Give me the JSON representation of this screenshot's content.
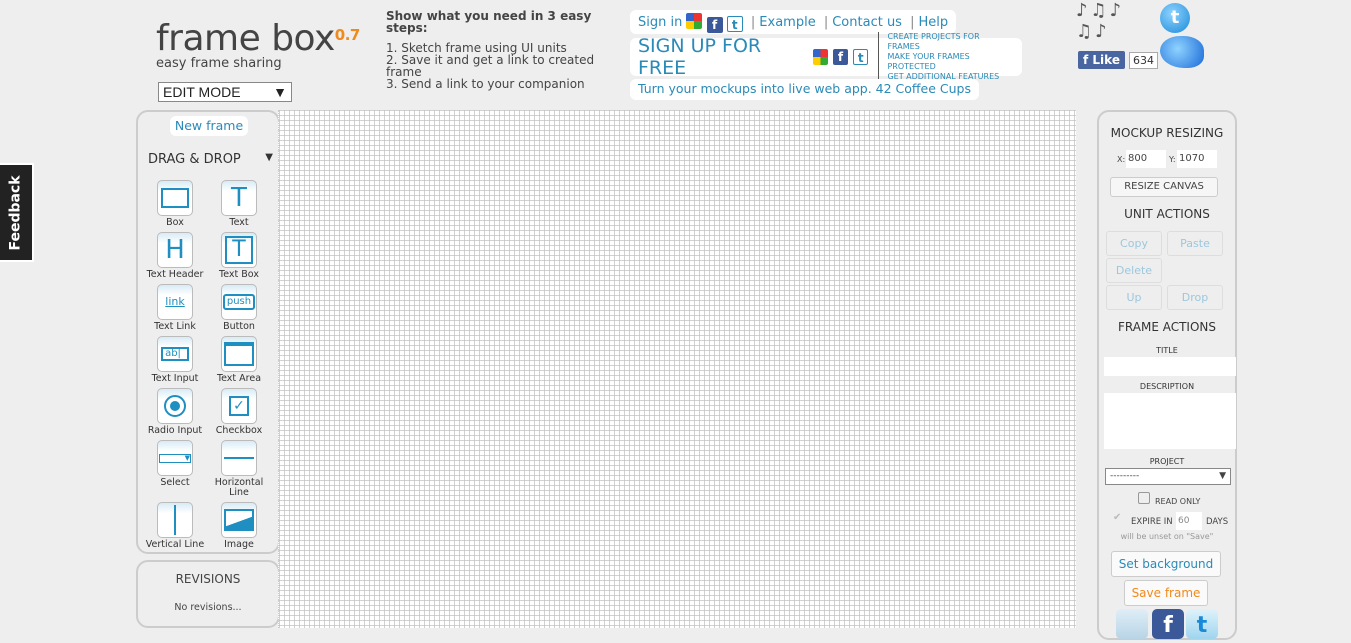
{
  "feedback": "Feedback",
  "logo": {
    "name": "frame box",
    "version": "0.7",
    "tagline": "easy frame sharing"
  },
  "mode_select": {
    "value": "EDIT MODE"
  },
  "steps": {
    "title": "Show what you need in 3 easy steps:",
    "items": [
      "1. Sketch frame using UI units",
      "2. Save it and get a link to created frame",
      "3. Send a link to your companion"
    ]
  },
  "topnav": {
    "sign_in": "Sign in",
    "links": [
      "Example",
      "Contact us",
      "Help"
    ]
  },
  "signup": {
    "label": "SIGN UP FOR FREE",
    "features": [
      "CREATE PROJECTS FOR FRAMES",
      "MAKE YOUR FRAMES PROTECTED",
      "GET ADDITIONAL FEATURES"
    ]
  },
  "promo": "Turn your mockups into live web app. 42 Coffee Cups",
  "facebook": {
    "like": "Like",
    "count": "634"
  },
  "left": {
    "new_frame": "New frame",
    "drag_drop": "DRAG & DROP",
    "tools": [
      {
        "label": "Box",
        "icon": "box"
      },
      {
        "label": "Text",
        "icon": "text"
      },
      {
        "label": "Text Header",
        "icon": "header"
      },
      {
        "label": "Text Box",
        "icon": "textbox"
      },
      {
        "label": "Text Link",
        "icon": "link"
      },
      {
        "label": "Button",
        "icon": "button"
      },
      {
        "label": "Text Input",
        "icon": "input"
      },
      {
        "label": "Text Area",
        "icon": "textarea"
      },
      {
        "label": "Radio Input",
        "icon": "radio"
      },
      {
        "label": "Checkbox",
        "icon": "checkbox"
      },
      {
        "label": "Select",
        "icon": "select"
      },
      {
        "label": "Horizontal Line",
        "icon": "hline"
      },
      {
        "label": "Vertical Line",
        "icon": "vline"
      },
      {
        "label": "Image",
        "icon": "image"
      }
    ],
    "glyphs": {
      "text": "T",
      "header": "H",
      "link": "link",
      "button": "push",
      "input": "ab"
    }
  },
  "revisions": {
    "title": "REVISIONS",
    "empty": "No revisions..."
  },
  "right": {
    "mockup_resizing": "MOCKUP RESIZING",
    "x_label": "X:",
    "x": "800",
    "y_label": "Y:",
    "y": "1070",
    "resize": "RESIZE CANVAS",
    "unit_actions": "UNIT ACTIONS",
    "copy": "Copy",
    "paste": "Paste",
    "delete": "Delete",
    "up": "Up",
    "drop": "Drop",
    "frame_actions": "FRAME ACTIONS",
    "title_label": "TITLE",
    "description_label": "DESCRIPTION",
    "project_label": "PROJECT",
    "project_value": "---------",
    "read_only": "READ ONLY",
    "expire_in": "EXPIRE IN",
    "expire_days": "60",
    "days": "DAYS",
    "unset_note": "will be unset on \"Save\"",
    "set_background": "Set background",
    "save_frame": "Save frame"
  },
  "colors": {
    "accent": "#2a8ab8",
    "orange": "#f08a1c",
    "background": "#eeeeee"
  }
}
